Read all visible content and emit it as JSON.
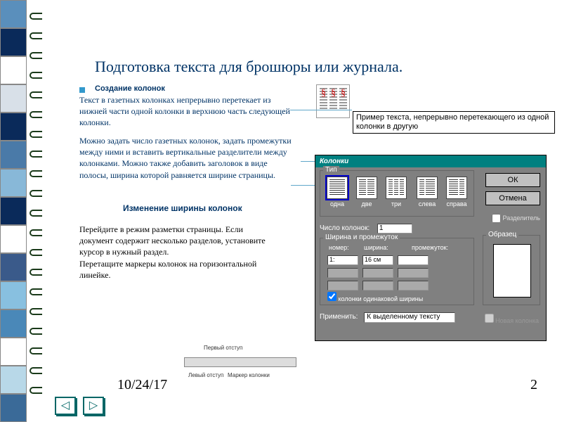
{
  "side_colors": [
    "#5a8fbc",
    "#0a2a5a",
    "#ffffff",
    "#d8e0e8",
    "#0a2a5a",
    "#4a7aa8",
    "#88b8d8",
    "#0a2a5a",
    "#ffffff",
    "#3a5a8a",
    "#88c0e0",
    "#4a88b8",
    "#ffffff",
    "#b8d8e8",
    "#3a6a98"
  ],
  "title": "Подготовка текста для брошюры или журнала.",
  "heading_sub": "Создание колонок",
  "para1": "Текст в газетных колонках непрерывно перетекает из нижней части одной колонки в верхнюю часть следующей колонки.",
  "para2": "Можно задать число газетных колонок, задать промежутки между ними и вставить вертикальные разделители между колонками. Можно также добавить заголовок в виде полосы, ширина которой равняется ширине страницы.",
  "heading_mid": "Изменение ширины колонок",
  "para3": "Перейдите в режим разметки страницы. Если документ содержит несколько разделов, установите курсор в нужный раздел.\nПеретащите маркеры колонок на горизонтальной линейке.",
  "tip": "Пример текста, непрерывно перетекающего из одной колонки в другую",
  "dialog": {
    "title": "Колонки",
    "group_type": "Тип",
    "opts": [
      "одна",
      "две",
      "три",
      "слева",
      "справа"
    ],
    "ok": "ОК",
    "cancel": "Отмена",
    "sep": "Разделитель",
    "num_label": "Число колонок:",
    "num_value": "1",
    "group_wp": "Ширина и промежуток",
    "wp_h1": "номер:",
    "wp_h2": "ширина:",
    "wp_h3": "промежуток:",
    "wp_r1_n": "1:",
    "wp_r1_w": "16 см",
    "eq": "колонки одинаковой ширины",
    "sample": "Образец",
    "apply_label": "Применить:",
    "apply_value": "К выделенному тексту",
    "new_col": "Новая колонка"
  },
  "ruler": {
    "t1": "Первый отступ",
    "t2": "Левый отступ",
    "t3": "Маркер колонки"
  },
  "footer": {
    "date": "10/24/17",
    "page": "2"
  }
}
